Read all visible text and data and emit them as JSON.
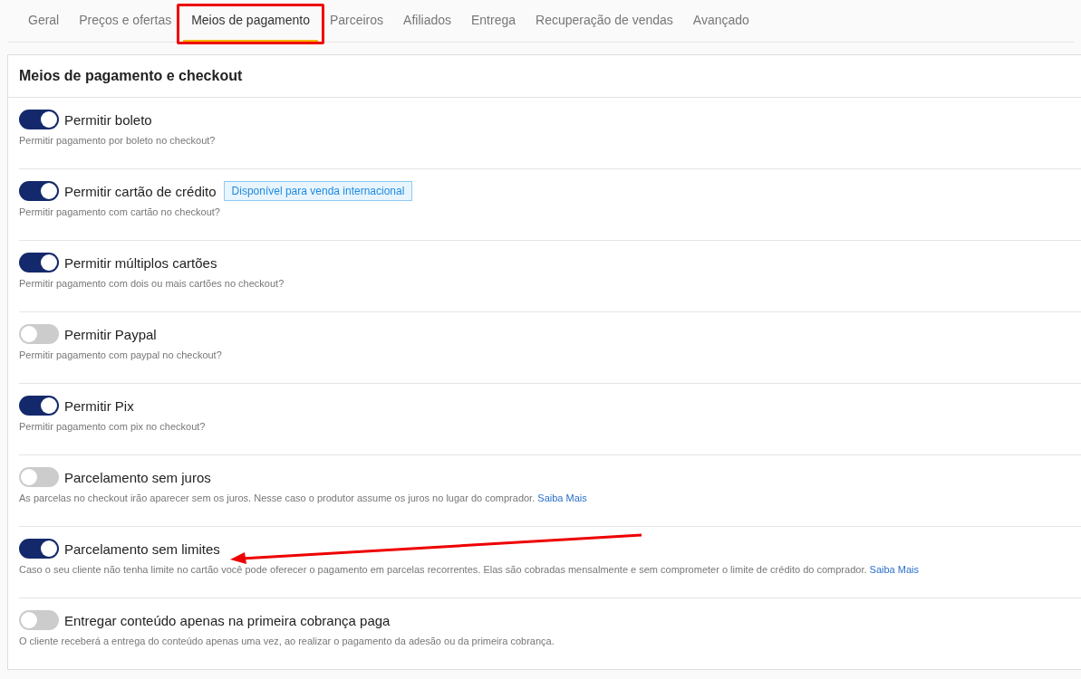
{
  "tabs": [
    {
      "label": "Geral",
      "selected": false
    },
    {
      "label": "Preços e ofertas",
      "selected": false
    },
    {
      "label": "Meios de pagamento",
      "selected": true
    },
    {
      "label": "Parceiros",
      "selected": false
    },
    {
      "label": "Afiliados",
      "selected": false
    },
    {
      "label": "Entrega",
      "selected": false
    },
    {
      "label": "Recuperação de vendas",
      "selected": false
    },
    {
      "label": "Avançado",
      "selected": false
    }
  ],
  "card": {
    "title": "Meios de pagamento e checkout",
    "settings": [
      {
        "label": "Permitir boleto",
        "on": true,
        "description": "Permitir pagamento por boleto no checkout?"
      },
      {
        "label": "Permitir cartão de crédito",
        "on": true,
        "badge": "Disponível para venda internacional",
        "description": "Permitir pagamento com cartão no checkout?"
      },
      {
        "label": "Permitir múltiplos cartões",
        "on": true,
        "description": "Permitir pagamento com dois ou mais cartões no checkout?"
      },
      {
        "label": "Permitir Paypal",
        "on": false,
        "description": "Permitir pagamento com paypal no checkout?"
      },
      {
        "label": "Permitir Pix",
        "on": true,
        "description": "Permitir pagamento com pix no checkout?"
      },
      {
        "label": "Parcelamento sem juros",
        "on": false,
        "description": "As parcelas no checkout irão aparecer sem os juros. Nesse caso o produtor assume os juros no lugar do comprador.",
        "link": "Saiba Mais"
      },
      {
        "label": "Parcelamento sem limites",
        "on": true,
        "description": "Caso o seu cliente não tenha limite no cartão você pode oferecer o pagamento em parcelas recorrentes. Elas são cobradas mensalmente e sem comprometer o limite de crédito do comprador.",
        "link": "Saiba Mais"
      },
      {
        "label": "Entregar conteúdo apenas na primeira cobrança paga",
        "on": false,
        "description": "O cliente receberá a entrega do conteúdo apenas uma vez, ao realizar o pagamento da adesão ou da primeira cobrança."
      }
    ]
  }
}
